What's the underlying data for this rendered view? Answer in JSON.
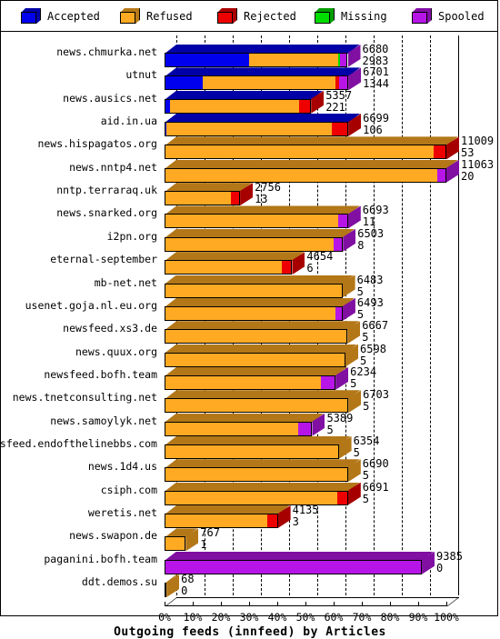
{
  "legend": {
    "items": [
      {
        "label": "Accepted",
        "color": "#0000EE",
        "icon": "cube-icon"
      },
      {
        "label": "Refused",
        "color": "#FFAA22",
        "icon": "cube-icon"
      },
      {
        "label": "Rejected",
        "color": "#EE0000",
        "icon": "cube-icon"
      },
      {
        "label": "Missing",
        "color": "#00DD00",
        "icon": "cube-icon"
      },
      {
        "label": "Spooled",
        "color": "#B715E8",
        "icon": "cube-icon"
      }
    ]
  },
  "chart_data": {
    "type": "bar",
    "orientation": "horizontal",
    "stacked": true,
    "percent_scale": true,
    "title": "Outgoing feeds (innfeed) by Articles",
    "xlabel": "Outgoing feeds (innfeed) by Articles",
    "ylabel": "",
    "xlim": [
      0,
      100
    ],
    "grid": true,
    "legend_position": "top",
    "xtick_labels": [
      "0%",
      "10%",
      "20%",
      "30%",
      "40%",
      "50%",
      "60%",
      "70%",
      "80%",
      "90%",
      "100%"
    ],
    "xtick_values": [
      0,
      10,
      20,
      30,
      40,
      50,
      60,
      70,
      80,
      90,
      100
    ],
    "series_names": [
      "Accepted",
      "Refused",
      "Rejected",
      "Missing",
      "Spooled"
    ],
    "series_colors": [
      "#0000EE",
      "#FFAA22",
      "#EE0000",
      "#00DD00",
      "#B715E8"
    ],
    "categories": [
      "news.chmurka.net",
      "utnut",
      "news.ausics.net",
      "aid.in.ua",
      "news.hispagatos.org",
      "news.nntp4.net",
      "nntp.terraraq.uk",
      "news.snarked.org",
      "i2pn.org",
      "eternal-september",
      "mb-net.net",
      "usenet.goja.nl.eu.org",
      "newsfeed.xs3.de",
      "news.quux.org",
      "newsfeed.bofh.team",
      "news.tnetconsulting.net",
      "news.samoylyk.net",
      "newsfeed.endofthelinebbs.com",
      "news.1d4.us",
      "csiph.com",
      "weretis.net",
      "news.swapon.de",
      "paganini.bofh.team",
      "ddt.demos.su"
    ],
    "rows": [
      {
        "name": "news.chmurka.net",
        "total": 6680,
        "second": 2983,
        "bar_pct": 65.0,
        "segments": [
          {
            "series": "Accepted",
            "pct": 30.0
          },
          {
            "series": "Refused",
            "pct": 31.5
          },
          {
            "series": "Missing",
            "pct": 0.6
          },
          {
            "series": "Spooled",
            "pct": 2.9
          }
        ]
      },
      {
        "name": "utnut",
        "total": 6701,
        "second": 1344,
        "bar_pct": 65.2,
        "segments": [
          {
            "series": "Accepted",
            "pct": 13.6
          },
          {
            "series": "Refused",
            "pct": 47.2
          },
          {
            "series": "Rejected",
            "pct": 1.2
          },
          {
            "series": "Spooled",
            "pct": 3.2
          }
        ]
      },
      {
        "name": "news.ausics.net",
        "total": 5357,
        "second": 221,
        "bar_pct": 52.0,
        "segments": [
          {
            "series": "Accepted",
            "pct": 1.9
          },
          {
            "series": "Refused",
            "pct": 45.7
          },
          {
            "series": "Rejected",
            "pct": 4.4
          }
        ]
      },
      {
        "name": "aid.in.ua",
        "total": 6699,
        "second": 106,
        "bar_pct": 65.2,
        "segments": [
          {
            "series": "Accepted",
            "pct": 0.7
          },
          {
            "series": "Refused",
            "pct": 58.7
          },
          {
            "series": "Rejected",
            "pct": 5.8
          }
        ]
      },
      {
        "name": "news.hispagatos.org",
        "total": 11009,
        "second": 53,
        "bar_pct": 100.0,
        "segments": [
          {
            "series": "Refused",
            "pct": 95.5
          },
          {
            "series": "Rejected",
            "pct": 4.5
          }
        ]
      },
      {
        "name": "news.nntp4.net",
        "total": 11063,
        "second": 20,
        "bar_pct": 100.5,
        "segments": [
          {
            "series": "Refused",
            "pct": 96.8
          },
          {
            "series": "Spooled",
            "pct": 3.2
          }
        ]
      },
      {
        "name": "nntp.terraraq.uk",
        "total": 2756,
        "second": 13,
        "bar_pct": 26.8,
        "segments": [
          {
            "series": "Refused",
            "pct": 23.6
          },
          {
            "series": "Rejected",
            "pct": 3.2
          }
        ]
      },
      {
        "name": "news.snarked.org",
        "total": 6693,
        "second": 11,
        "bar_pct": 65.1,
        "segments": [
          {
            "series": "Refused",
            "pct": 61.6
          },
          {
            "series": "Spooled",
            "pct": 3.5
          }
        ]
      },
      {
        "name": "i2pn.org",
        "total": 6503,
        "second": 8,
        "bar_pct": 63.3,
        "segments": [
          {
            "series": "Refused",
            "pct": 60.0
          },
          {
            "series": "Spooled",
            "pct": 3.3
          }
        ]
      },
      {
        "name": "eternal-september",
        "total": 4654,
        "second": 6,
        "bar_pct": 45.3,
        "segments": [
          {
            "series": "Refused",
            "pct": 41.6
          },
          {
            "series": "Rejected",
            "pct": 3.7
          }
        ]
      },
      {
        "name": "mb-net.net",
        "total": 6483,
        "second": 5,
        "bar_pct": 63.1,
        "segments": [
          {
            "series": "Refused",
            "pct": 63.1
          }
        ]
      },
      {
        "name": "usenet.goja.nl.eu.org",
        "total": 6493,
        "second": 5,
        "bar_pct": 63.2,
        "segments": [
          {
            "series": "Refused",
            "pct": 60.5
          },
          {
            "series": "Spooled",
            "pct": 2.7
          }
        ]
      },
      {
        "name": "newsfeed.xs3.de",
        "total": 6667,
        "second": 5,
        "bar_pct": 64.9,
        "segments": [
          {
            "series": "Refused",
            "pct": 64.9
          }
        ]
      },
      {
        "name": "news.quux.org",
        "total": 6598,
        "second": 5,
        "bar_pct": 64.2,
        "segments": [
          {
            "series": "Refused",
            "pct": 64.2
          }
        ]
      },
      {
        "name": "newsfeed.bofh.team",
        "total": 6234,
        "second": 5,
        "bar_pct": 60.7,
        "segments": [
          {
            "series": "Refused",
            "pct": 55.5
          },
          {
            "series": "Spooled",
            "pct": 5.2
          }
        ]
      },
      {
        "name": "news.tnetconsulting.net",
        "total": 6703,
        "second": 5,
        "bar_pct": 65.2,
        "segments": [
          {
            "series": "Refused",
            "pct": 65.2
          }
        ]
      },
      {
        "name": "news.samoylyk.net",
        "total": 5389,
        "second": 5,
        "bar_pct": 52.4,
        "segments": [
          {
            "series": "Refused",
            "pct": 47.4
          },
          {
            "series": "Spooled",
            "pct": 5.0
          }
        ]
      },
      {
        "name": "newsfeed.endofthelinebbs.com",
        "total": 6354,
        "second": 5,
        "bar_pct": 61.8,
        "segments": [
          {
            "series": "Refused",
            "pct": 61.8
          }
        ]
      },
      {
        "name": "news.1d4.us",
        "total": 6690,
        "second": 5,
        "bar_pct": 65.1,
        "segments": [
          {
            "series": "Refused",
            "pct": 65.1
          }
        ]
      },
      {
        "name": "csiph.com",
        "total": 6691,
        "second": 5,
        "bar_pct": 65.1,
        "segments": [
          {
            "series": "Refused",
            "pct": 61.3
          },
          {
            "series": "Rejected",
            "pct": 3.8
          }
        ]
      },
      {
        "name": "weretis.net",
        "total": 4135,
        "second": 3,
        "bar_pct": 40.2,
        "segments": [
          {
            "series": "Refused",
            "pct": 36.4
          },
          {
            "series": "Rejected",
            "pct": 3.8
          }
        ]
      },
      {
        "name": "news.swapon.de",
        "total": 767,
        "second": 1,
        "bar_pct": 7.5,
        "segments": [
          {
            "series": "Refused",
            "pct": 7.5
          }
        ]
      },
      {
        "name": "paganini.bofh.team",
        "total": 9385,
        "second": 0,
        "bar_pct": 91.3,
        "segments": [
          {
            "series": "Spooled",
            "pct": 91.3
          }
        ]
      },
      {
        "name": "ddt.demos.su",
        "total": 68,
        "second": 0,
        "bar_pct": 0.7,
        "segments": [
          {
            "series": "Refused",
            "pct": 0.7
          }
        ]
      }
    ]
  }
}
